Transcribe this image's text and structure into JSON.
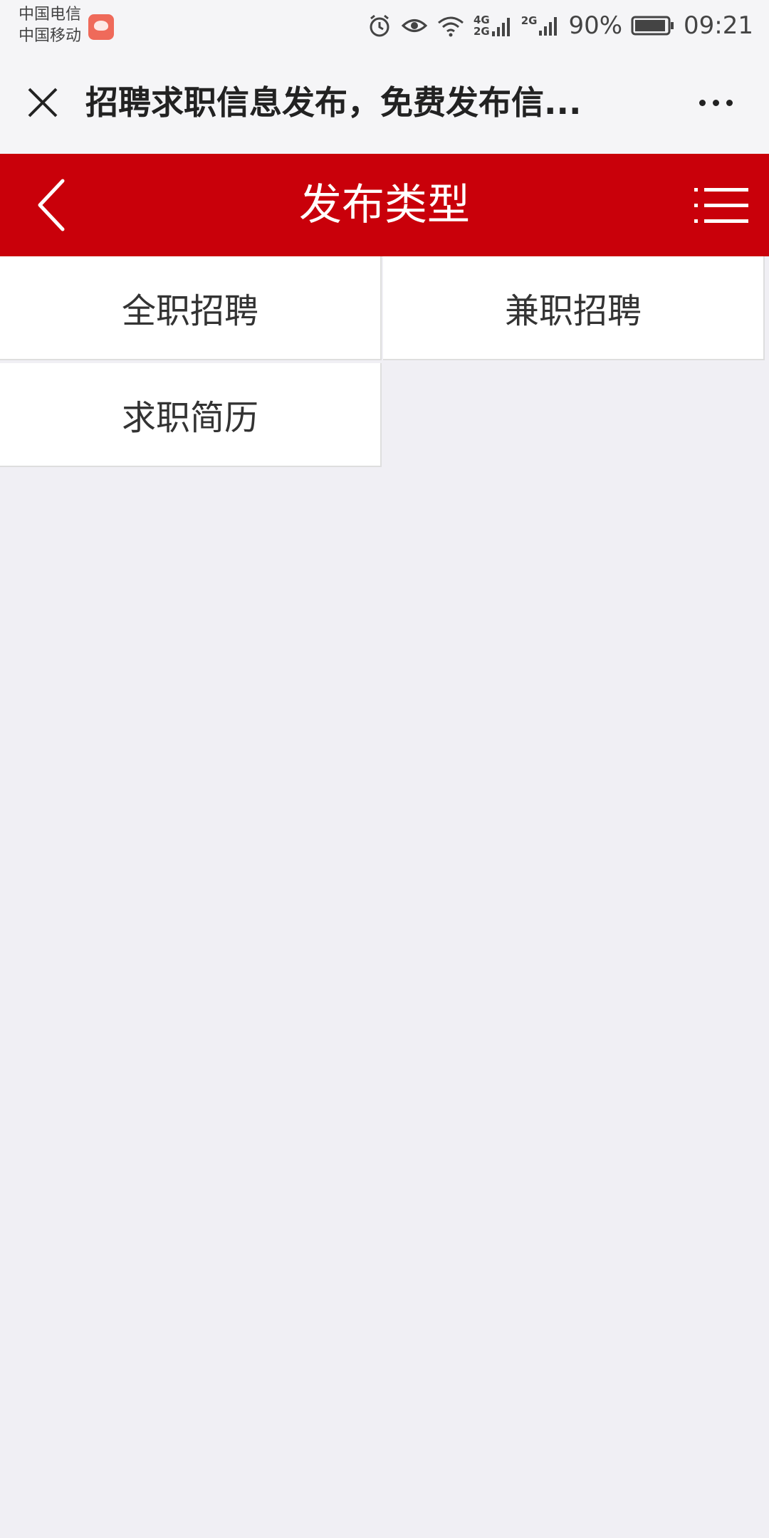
{
  "status_bar": {
    "carrier_1": "中国电信",
    "carrier_2": "中国移动",
    "network_1": "4G",
    "network_2": "2G",
    "network_3": "2G",
    "battery_percent": "90%",
    "time": "09:21"
  },
  "webview": {
    "title": "招聘求职信息发布，免费发布信..."
  },
  "header": {
    "title": "发布类型",
    "color": "#c9000a"
  },
  "categories": [
    {
      "label": "全职招聘"
    },
    {
      "label": "兼职招聘"
    },
    {
      "label": "求职简历"
    }
  ]
}
